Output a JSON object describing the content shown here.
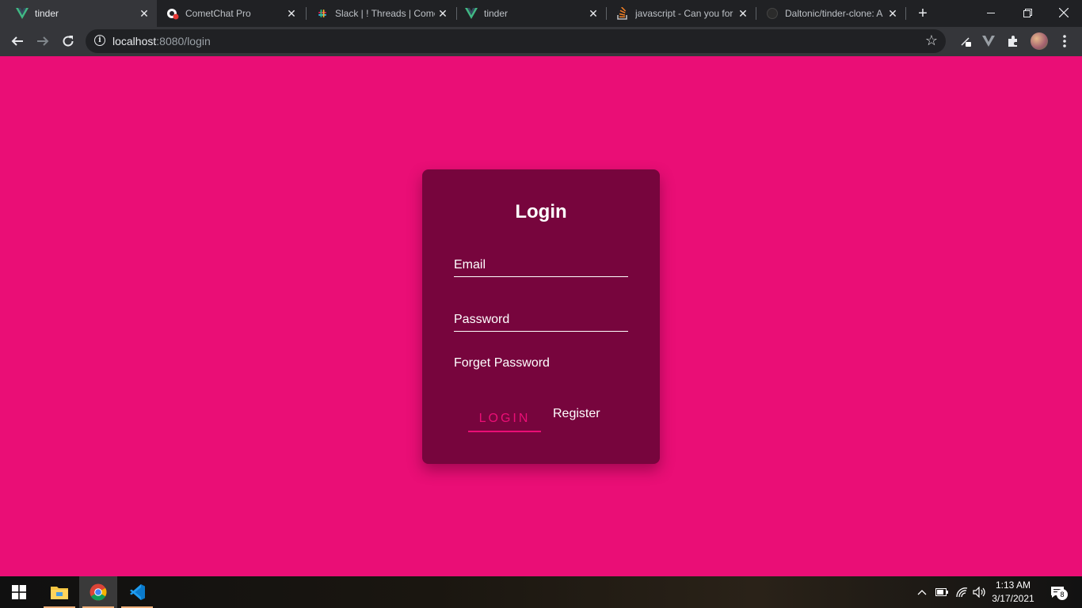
{
  "browser": {
    "tabs": [
      {
        "title": "tinder",
        "icon": "vue-icon",
        "active": true
      },
      {
        "title": "CometChat Pro",
        "icon": "cometchat-icon",
        "active": false
      },
      {
        "title": "Slack | ! Threads | Come",
        "icon": "slack-icon",
        "active": false
      },
      {
        "title": "tinder",
        "icon": "vue-icon",
        "active": false
      },
      {
        "title": "javascript - Can you for",
        "icon": "stackoverflow-icon",
        "active": false
      },
      {
        "title": "Daltonic/tinder-clone: A",
        "icon": "github-icon",
        "active": false
      }
    ],
    "url_host": "localhost",
    "url_path": ":8080/login"
  },
  "login": {
    "title": "Login",
    "email_placeholder": "Email",
    "password_placeholder": "Password",
    "forget_label": "Forget Password",
    "login_label": "LOGIN",
    "register_label": "Register"
  },
  "taskbar": {
    "time": "1:13 AM",
    "date": "3/17/2021",
    "notifications": "8"
  },
  "colors": {
    "page_bg": "#ea0e76",
    "card_bg": "#77053d",
    "accent": "#ea0e76"
  }
}
